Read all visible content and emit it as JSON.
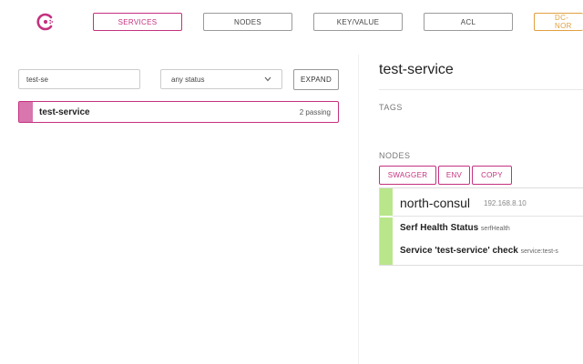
{
  "nav": {
    "items": [
      {
        "label": "SERVICES"
      },
      {
        "label": "NODES"
      },
      {
        "label": "KEY/VALUE"
      },
      {
        "label": "ACL"
      },
      {
        "label": "DC-NOR"
      }
    ],
    "active": "SERVICES"
  },
  "services_panel": {
    "filter": {
      "value": "test-se"
    },
    "status_select": {
      "value": "any status"
    },
    "expand_label": "EXPAND",
    "services": [
      {
        "name": "test-service",
        "status": "2 passing"
      }
    ]
  },
  "detail": {
    "title": "test-service",
    "tags_label": "TAGS",
    "nodes_label": "NODES",
    "buttons": {
      "swagger": "SWAGGER",
      "env": "ENV",
      "copy": "COPY"
    },
    "node": {
      "name": "north-consul",
      "ip": "192.168.8.10",
      "checks": [
        {
          "name": "Serf Health Status",
          "id": "serfHealth"
        },
        {
          "name": "Service 'test-service' check",
          "id": "service:test-s"
        }
      ]
    }
  },
  "colors": {
    "accent": "#c4317f",
    "dc": "#e0a040",
    "passing": "#b9e68a",
    "service_health": "#d876ad"
  },
  "icons": {
    "logo": "consul-logo-icon",
    "select_chevron": "chevron-down-icon"
  }
}
